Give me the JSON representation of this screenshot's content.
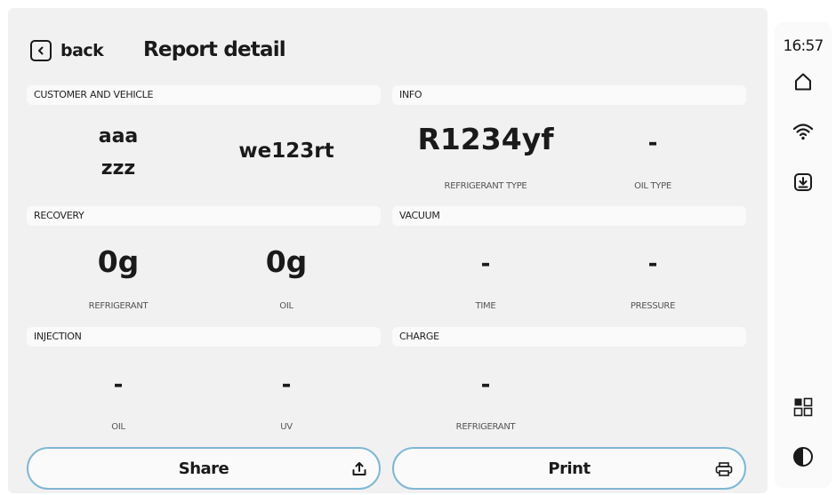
{
  "header": {
    "back_label": "back",
    "title": "Report detail"
  },
  "sections": {
    "customer": {
      "title": "CUSTOMER AND VEHICLE",
      "name_line1": "aaa",
      "name_line2": "zzz",
      "plate": "we123rt"
    },
    "info": {
      "title": "INFO",
      "refrigerant_value": "R1234yf",
      "refrigerant_label": "REFRIGERANT TYPE",
      "oil_value": "-",
      "oil_label": "OIL TYPE"
    },
    "recovery": {
      "title": "RECOVERY",
      "refrigerant_value": "0g",
      "refrigerant_label": "REFRIGERANT",
      "oil_value": "0g",
      "oil_label": "OIL"
    },
    "vacuum": {
      "title": "VACUUM",
      "time_value": "-",
      "time_label": "TIME",
      "pressure_value": "-",
      "pressure_label": "PRESSURE"
    },
    "injection": {
      "title": "INJECTION",
      "oil_value": "-",
      "oil_label": "OIL",
      "uv_value": "-",
      "uv_label": "UV"
    },
    "charge": {
      "title": "CHARGE",
      "refrigerant_value": "-",
      "refrigerant_label": "REFRIGERANT"
    }
  },
  "actions": {
    "share_label": "Share",
    "print_label": "Print"
  },
  "sidebar": {
    "time": "16:57",
    "icons": [
      "home-icon",
      "wifi-icon",
      "download-icon",
      "apps-grid-icon",
      "contrast-icon"
    ]
  },
  "colors": {
    "button_border": "#7fb7d4",
    "panel_bg": "#f1f1f1",
    "header_bg": "#fafafa"
  }
}
